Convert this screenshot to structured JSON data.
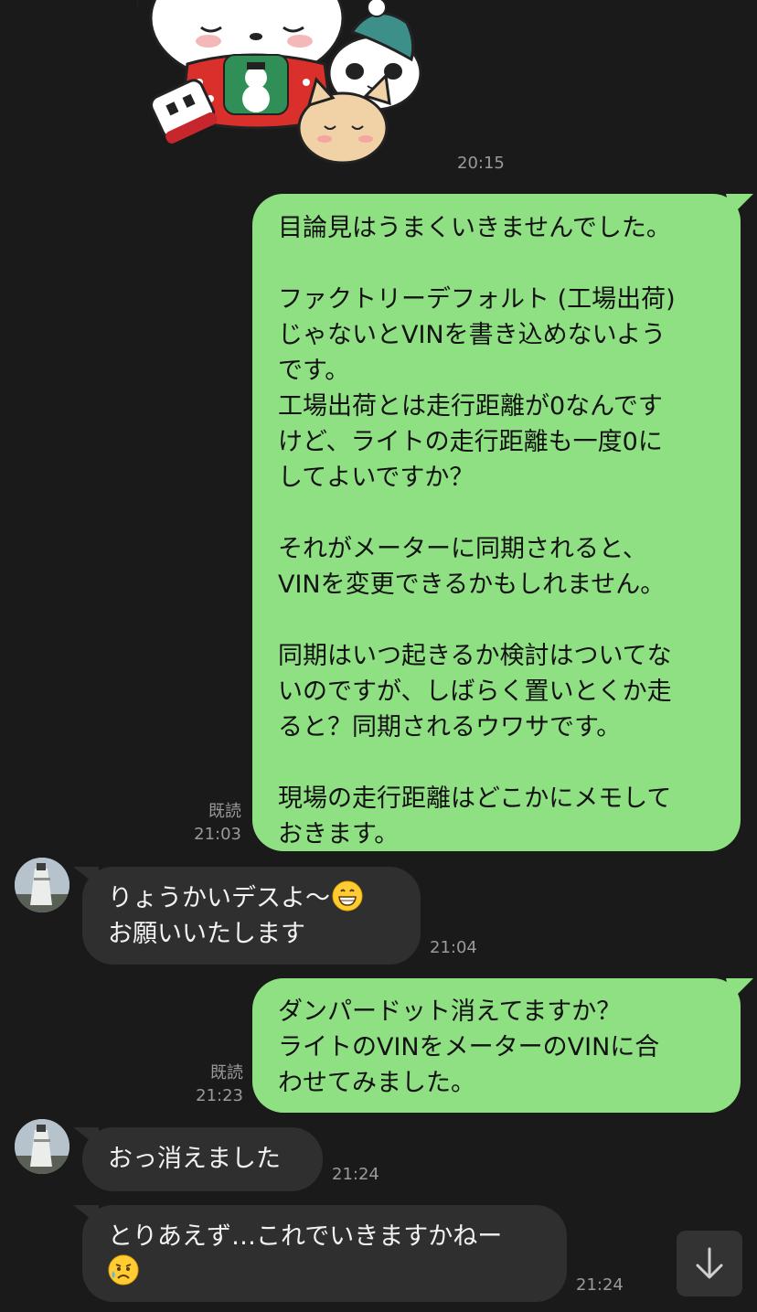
{
  "sticker": {
    "time": "20:15"
  },
  "messages": {
    "m1": {
      "lines": [
        "目論見はうまくいきませんでした。",
        "",
        "ファクトリーデフォルト (工場出荷)",
        "じゃないとVINを書き込めないよう",
        "です。",
        "工場出荷とは走行距離が0なんです",
        "けど、ライトの走行距離も一度0に",
        "してよいですか？",
        "",
        "それがメーターに同期されると、",
        "VINを変更できるかもしれません。",
        "",
        "同期はいつ起きるか検討はついてな",
        "いのですが、しばらく置いとくか走",
        "ると？同期されるウワサです。",
        "",
        "現場の走行距離はどこかにメモして",
        "おきます。"
      ],
      "read": "既読",
      "time": "21:03"
    },
    "m2": {
      "lines": [
        "りょうかいデスよ〜",
        "お願いいたします"
      ],
      "emoji": "grinning-face-emoji",
      "time": "21:04"
    },
    "m3": {
      "lines": [
        "ダンパードット消えてますか？",
        "ライトのVINをメーターのVINに合",
        "わせてみました。"
      ],
      "read": "既読",
      "time": "21:23"
    },
    "m4": {
      "lines": [
        "おっ消えました"
      ],
      "time": "21:24"
    },
    "m5": {
      "lines": [
        "とりあえず…これでいきますかねー"
      ],
      "emoji": "sad-relieved-face-emoji",
      "time": "21:24"
    }
  },
  "colors": {
    "background": "#1a1a1a",
    "outgoing_bubble": "#8fe083",
    "incoming_bubble": "#2f2f2f",
    "meta_text": "#9a9a9a"
  },
  "icons": {
    "scroll_down": "chevron-down-icon",
    "avatar": "lighthouse-avatar"
  }
}
